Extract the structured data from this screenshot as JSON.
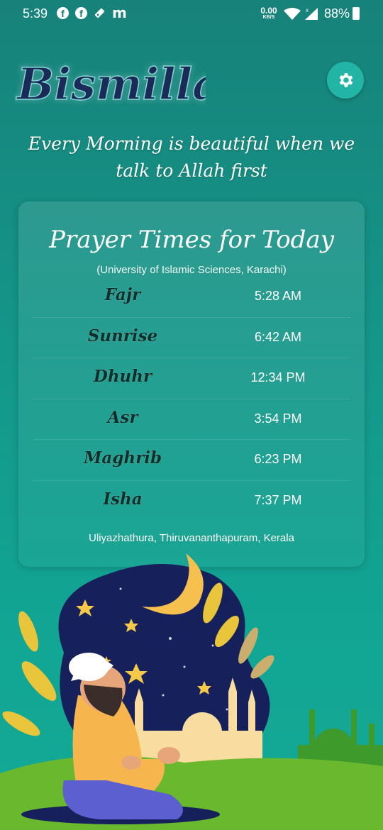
{
  "status_bar": {
    "time": "5:39",
    "net_speed_value": "0.00",
    "net_speed_unit": "KB/S",
    "battery": "88%",
    "left_icons": [
      "facebook-icon",
      "facebook-icon",
      "tag-icon",
      "m-logo-icon"
    ],
    "right_icons": [
      "wifi-icon",
      "cell-signal-icon",
      "battery-charging-icon"
    ]
  },
  "header": {
    "logo_text": "Bismillah",
    "settings_icon": "gear-icon",
    "tagline": "Every Morning is beautiful when we talk to Allah first"
  },
  "prayer_card": {
    "title": "Prayer Times for Today",
    "method": "(University of Islamic Sciences, Karachi)",
    "prayers": [
      {
        "name": "Fajr",
        "time": "5:28 AM"
      },
      {
        "name": "Sunrise",
        "time": "6:42 AM"
      },
      {
        "name": "Dhuhr",
        "time": "12:34 PM"
      },
      {
        "name": "Asr",
        "time": "3:54 PM"
      },
      {
        "name": "Maghrib",
        "time": "6:23 PM"
      },
      {
        "name": "Isha",
        "time": "7:37 PM"
      }
    ],
    "location": "Uliyazhathura, Thiruvananthapuram, Kerala"
  },
  "colors": {
    "background_top": "#17827a",
    "background_bottom": "#14a996",
    "logo_navy": "#1b2a5a",
    "settings_button": "#22b5a6",
    "prayer_name": "#0d2f2b"
  }
}
